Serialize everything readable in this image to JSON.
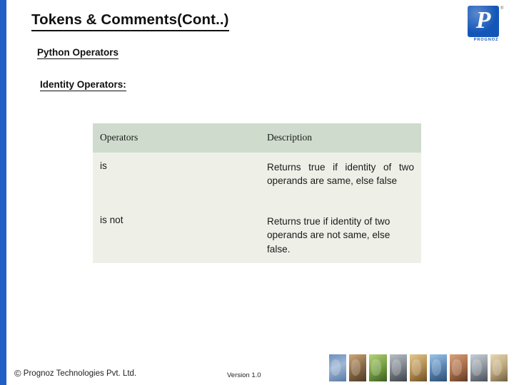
{
  "slide": {
    "title": "Tokens & Comments(Cont..)",
    "section_heading": "Python Operators",
    "sub_heading": "Identity Operators:"
  },
  "logo": {
    "glyph": "P",
    "registered": "®",
    "wordmark": "PROGNOZ"
  },
  "table": {
    "headers": [
      "Operators",
      "Description"
    ],
    "rows": [
      {
        "operator": "is",
        "description": "Returns true if identity of two operands are same, else false"
      },
      {
        "operator": "is not",
        "description": "Returns true if identity of two operands are not same, else false."
      }
    ]
  },
  "footer": {
    "copyright_mark": "©",
    "copyright": "Prognoz Technologies Pvt. Ltd.",
    "version": "Version 1.0"
  },
  "colors": {
    "accent_bar": "#1f5ec4",
    "logo_blue": "#1456b8",
    "table_header_bg": "#cfdccd",
    "table_body_bg": "#eef0e8"
  }
}
